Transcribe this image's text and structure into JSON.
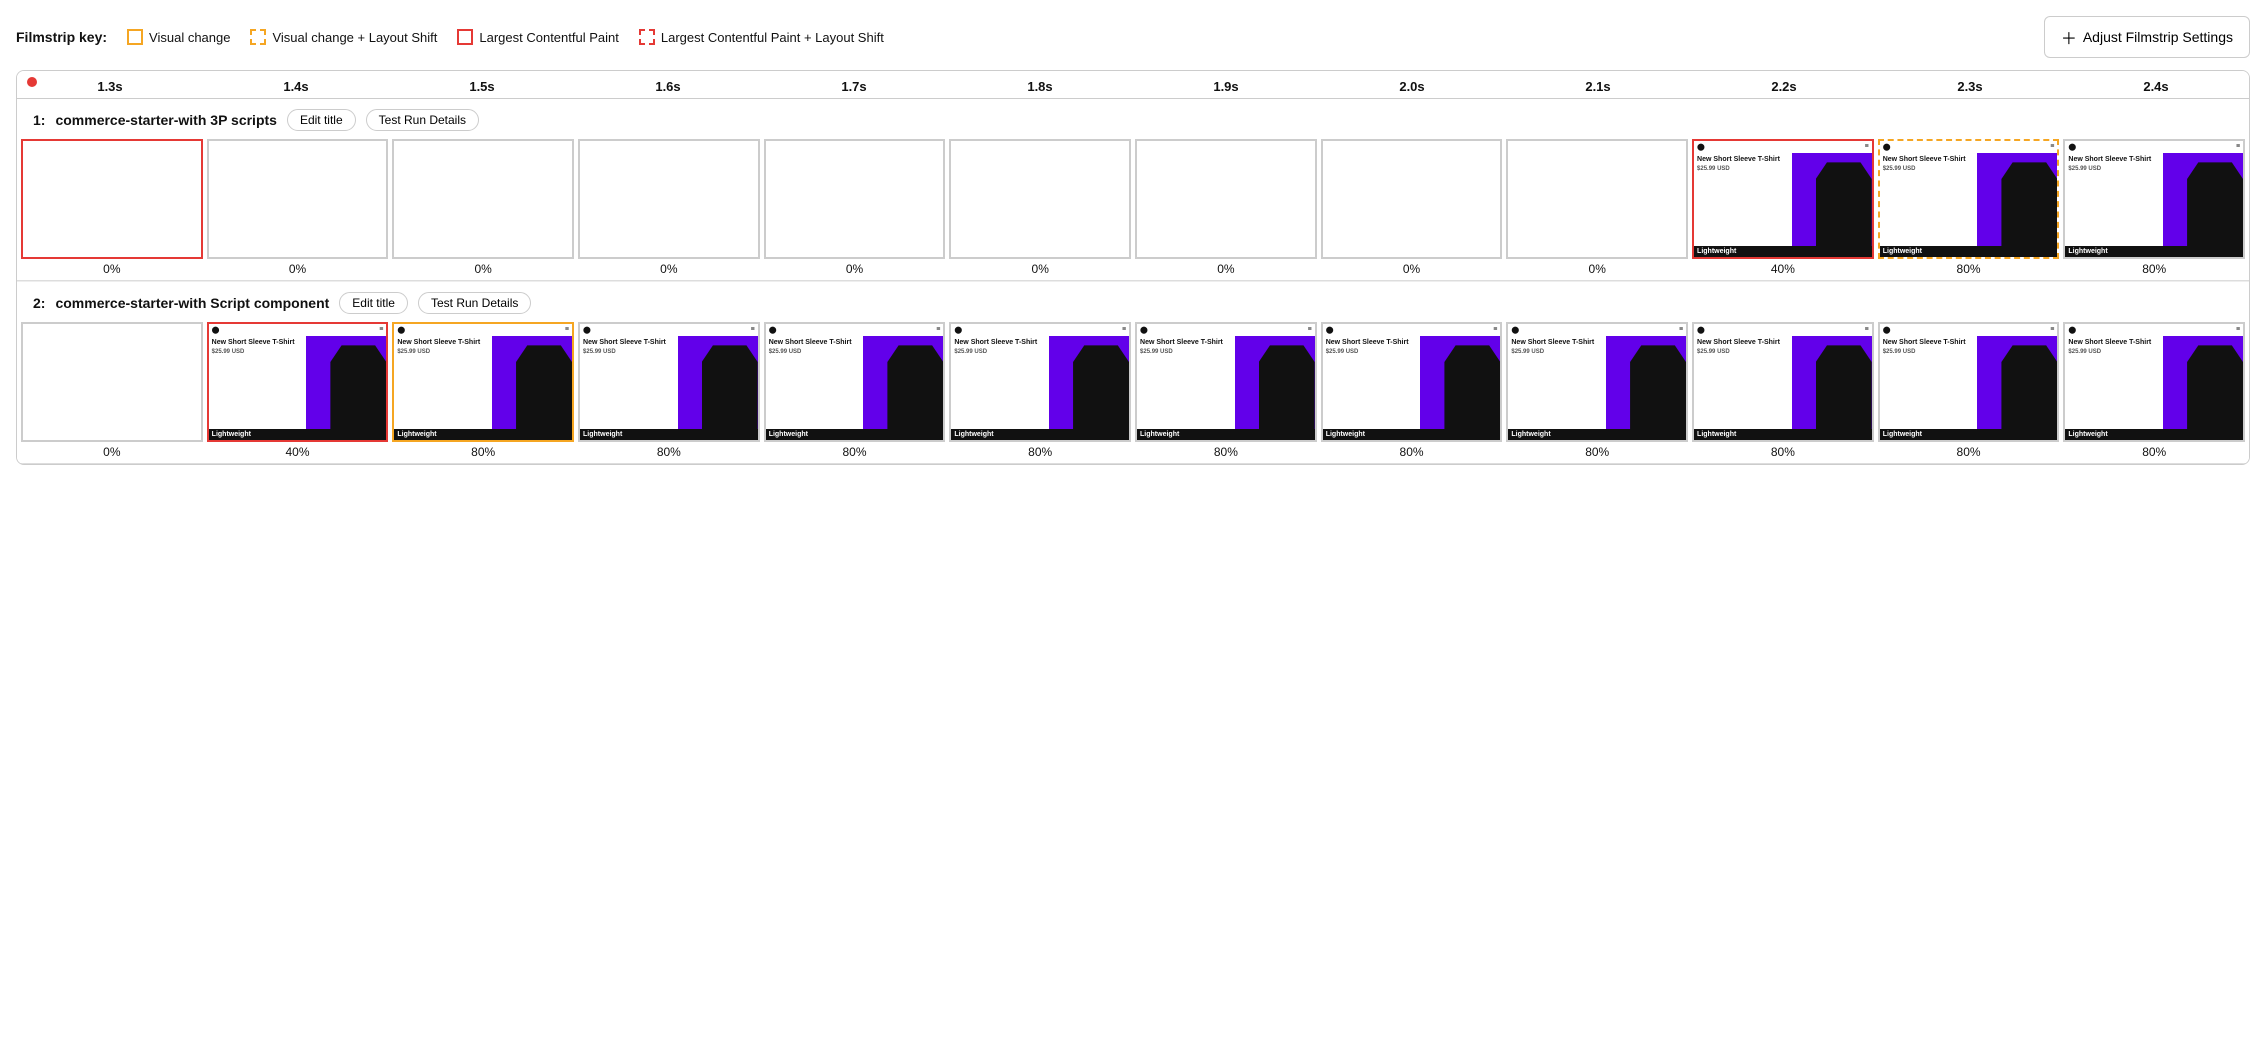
{
  "legend": {
    "title": "Filmstrip key:",
    "items": [
      {
        "id": "visual-change",
        "label": "Visual change",
        "type": "solid-orange"
      },
      {
        "id": "visual-change-ls",
        "label": "Visual change + Layout Shift",
        "type": "dashed-orange"
      },
      {
        "id": "lcp",
        "label": "Largest Contentful Paint",
        "type": "solid-red"
      },
      {
        "id": "lcp-ls",
        "label": "Largest Contentful Paint + Layout Shift",
        "type": "dashed-red"
      }
    ]
  },
  "adjust_button": "Adjust Filmstrip Settings",
  "timeline": {
    "ticks": [
      "1.3s",
      "1.4s",
      "1.5s",
      "1.6s",
      "1.7s",
      "1.8s",
      "1.9s",
      "2.0s",
      "2.1s",
      "2.2s",
      "2.3s",
      "2.4s"
    ]
  },
  "rows": [
    {
      "id": "row1",
      "number": "1:",
      "title": "commerce-starter-with 3P scripts",
      "edit_btn": "Edit title",
      "details_btn": "Test Run Details",
      "frames": [
        {
          "type": "blank",
          "border": "red",
          "percent": "0%"
        },
        {
          "type": "blank",
          "border": "normal",
          "percent": "0%"
        },
        {
          "type": "blank",
          "border": "normal",
          "percent": "0%"
        },
        {
          "type": "blank",
          "border": "normal",
          "percent": "0%"
        },
        {
          "type": "blank",
          "border": "normal",
          "percent": "0%"
        },
        {
          "type": "blank",
          "border": "normal",
          "percent": "0%"
        },
        {
          "type": "blank",
          "border": "normal",
          "percent": "0%"
        },
        {
          "type": "blank",
          "border": "normal",
          "percent": "0%"
        },
        {
          "type": "blank",
          "border": "normal",
          "percent": "0%"
        },
        {
          "type": "product",
          "border": "red",
          "percent": "40%"
        },
        {
          "type": "product",
          "border": "orange-dashed",
          "percent": "80%"
        },
        {
          "type": "product",
          "border": "normal",
          "percent": "80%"
        }
      ]
    },
    {
      "id": "row2",
      "number": "2:",
      "title": "commerce-starter-with Script component",
      "edit_btn": "Edit title",
      "details_btn": "Test Run Details",
      "frames": [
        {
          "type": "blank",
          "border": "normal",
          "percent": "0%"
        },
        {
          "type": "product",
          "border": "red",
          "percent": "40%"
        },
        {
          "type": "product",
          "border": "orange",
          "percent": "80%"
        },
        {
          "type": "product",
          "border": "normal",
          "percent": "80%"
        },
        {
          "type": "product",
          "border": "normal",
          "percent": "80%"
        },
        {
          "type": "product",
          "border": "normal",
          "percent": "80%"
        },
        {
          "type": "product",
          "border": "normal",
          "percent": "80%"
        },
        {
          "type": "product",
          "border": "normal",
          "percent": "80%"
        },
        {
          "type": "product",
          "border": "normal",
          "percent": "80%"
        },
        {
          "type": "product",
          "border": "normal",
          "percent": "80%"
        },
        {
          "type": "product",
          "border": "normal",
          "percent": "80%"
        },
        {
          "type": "product",
          "border": "normal",
          "percent": "80%"
        }
      ]
    }
  ],
  "product": {
    "title": "New Short Sleeve T-Shirt",
    "price": "$25.99 USD",
    "footer": "Lightweight"
  }
}
